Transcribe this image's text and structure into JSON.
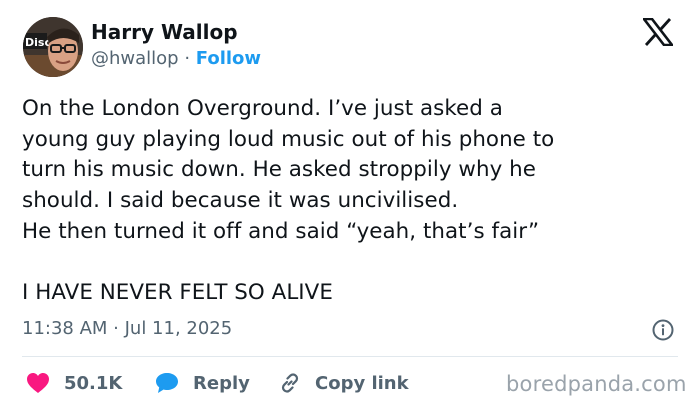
{
  "author": {
    "name": "Harry Wallop",
    "handle": "@hwallop",
    "separator": " · ",
    "follow_label": "Follow",
    "avatar_sign_text": "Disc"
  },
  "tweet": {
    "text": "On the London Overground. I’ve just asked a\nyoung guy playing loud music out of his phone to\nturn his music down. He asked stroppily why he\nshould. I said because it was uncivilised.\nHe then turned it off and said “yeah, that’s fair”\n\nI HAVE NEVER FELT SO ALIVE",
    "timestamp": "11:38 AM · Jul 11, 2025"
  },
  "actions": {
    "likes": "50.1K",
    "reply_label": "Reply",
    "copy_label": "Copy link"
  },
  "watermark": "boredpanda.com",
  "icons": {
    "logo": "x-logo-icon",
    "info": "info-icon",
    "like": "heart-icon",
    "reply": "speech-bubble-icon",
    "copy": "link-icon"
  },
  "colors": {
    "text": "#0f1419",
    "secondary": "#536471",
    "link": "#1d9bf0",
    "heart": "#f91880",
    "reply": "#1d9bf0",
    "divider": "#e1e8ed",
    "watermark": "#9aa3ab"
  }
}
